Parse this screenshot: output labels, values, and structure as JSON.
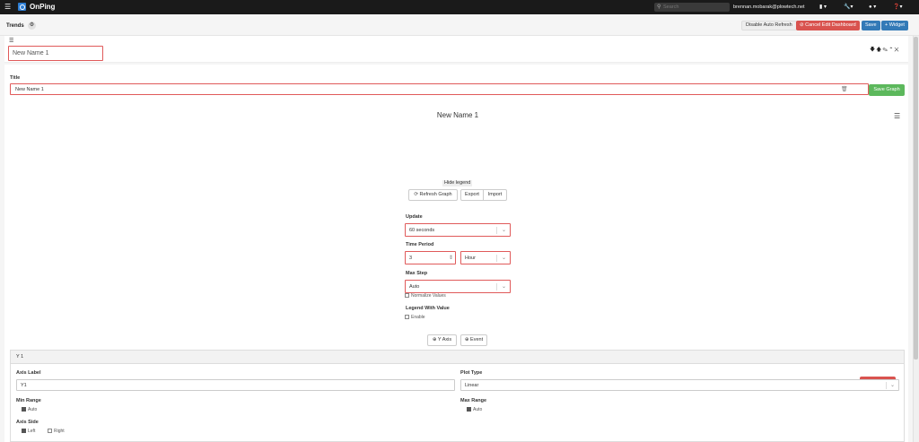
{
  "nav": {
    "brand": "OnPing",
    "search_placeholder": "Search",
    "user_email": "brennan.mobarak@plowtech.net",
    "icons": [
      "bookmark-icon",
      "wrench-icon",
      "user-icon",
      "question-icon"
    ]
  },
  "toolbar": {
    "title": "Trends",
    "disable_auto_refresh": "Disable Auto Refresh",
    "cancel_edit": "Cancel Edit Dashboard",
    "save": "Save",
    "add_widget": "Widget"
  },
  "card": {
    "name_value": "New Name 1"
  },
  "editor": {
    "title_label": "Title",
    "title_value": "New Name 1",
    "save_graph": "Save Graph",
    "chart_title": "New Name 1",
    "hide_legend": "Hide legend",
    "refresh_graph": "Refresh Graph",
    "export": "Export",
    "import": "Import",
    "update_label": "Update",
    "update_value": "60 seconds",
    "time_period_label": "Time Period",
    "time_period_value": "3",
    "time_unit_value": "Hour",
    "max_step_label": "Max Step",
    "max_step_value": "Auto",
    "normalize_values": "Normalize Values",
    "legend_with_value_label": "Legend With Value",
    "enable": "Enable",
    "y_axis_button": "Y Axis",
    "event_button": "Event"
  },
  "y_axis": {
    "header": "Y 1",
    "axis_label_label": "Axis Label",
    "axis_label_value": "Y1",
    "plot_type_label": "Plot Type",
    "plot_type_value": "Linear",
    "min_range_label": "Min Range",
    "min_auto": "Auto",
    "max_range_label": "Max Range",
    "max_auto": "Auto",
    "axis_side_label": "Axis Side",
    "left": "Left",
    "right": "Right"
  }
}
